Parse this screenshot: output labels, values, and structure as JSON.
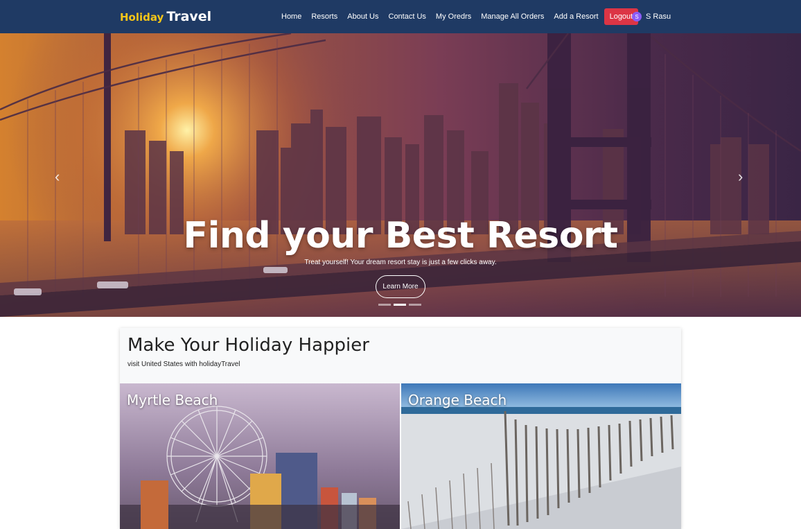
{
  "brand": {
    "part1": "Holiday",
    "part2": "Travel"
  },
  "nav": {
    "links": [
      "Home",
      "Resorts",
      "About Us",
      "Contact Us",
      "My Oredrs",
      "Manage All Orders",
      "Add a Resort"
    ],
    "logout": "Logout",
    "user_initial": "S",
    "user_name": "S Rasu"
  },
  "hero": {
    "title": "Find your Best Resort",
    "subtitle": "Treat yourself! Your dream resort stay is just a few clicks away.",
    "button": "Learn More",
    "prev_icon": "chevron-left-icon",
    "next_icon": "chevron-right-icon",
    "slides": 3,
    "active_slide": 2
  },
  "section": {
    "title": "Make Your Holiday Happier",
    "subtitle": "visit United States with holidayTravel",
    "destinations": [
      "Myrtle Beach",
      "Orange Beach"
    ]
  },
  "colors": {
    "navbar": "#1f3a64",
    "brand_accent": "#f5c518",
    "logout": "#dc3545",
    "avatar": "#8b5cf6"
  }
}
